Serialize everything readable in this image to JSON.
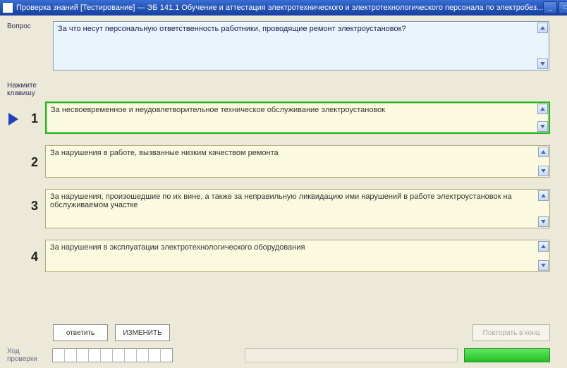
{
  "window": {
    "title": "Проверка знаний [Тестирование] — ЭБ 141.1 Обучение и аттестация электротехнического и электротехнологического персонала по электробез..."
  },
  "labels": {
    "question": "Вопрос",
    "answers_hint": "Нажмите клавишу",
    "progress": "Ход проверки"
  },
  "question": {
    "text": "За что несут персональную ответственность работники, проводящие ремонт электроустановок?"
  },
  "answers": [
    {
      "num": "1",
      "text": "За несвоевременное и неудовлетворительное техническое обслуживание электроустановок",
      "selected": true
    },
    {
      "num": "2",
      "text": "За нарушения в работе, вызванные низким качеством ремонта",
      "selected": false
    },
    {
      "num": "3",
      "text": "За нарушения, произошедшие по их вине, а также за неправильную ликвидацию ими нарушений в работе электроустановок на обслуживаемом участке",
      "selected": false
    },
    {
      "num": "4",
      "text": "За нарушения в эксплуатации электротехнологического оборудования",
      "selected": false
    }
  ],
  "buttons": {
    "confirm": "ответить",
    "cancel": "ИЗМЕНИТЬ",
    "next": "Повторить в конц"
  },
  "progress": {
    "total_cells": 10
  }
}
